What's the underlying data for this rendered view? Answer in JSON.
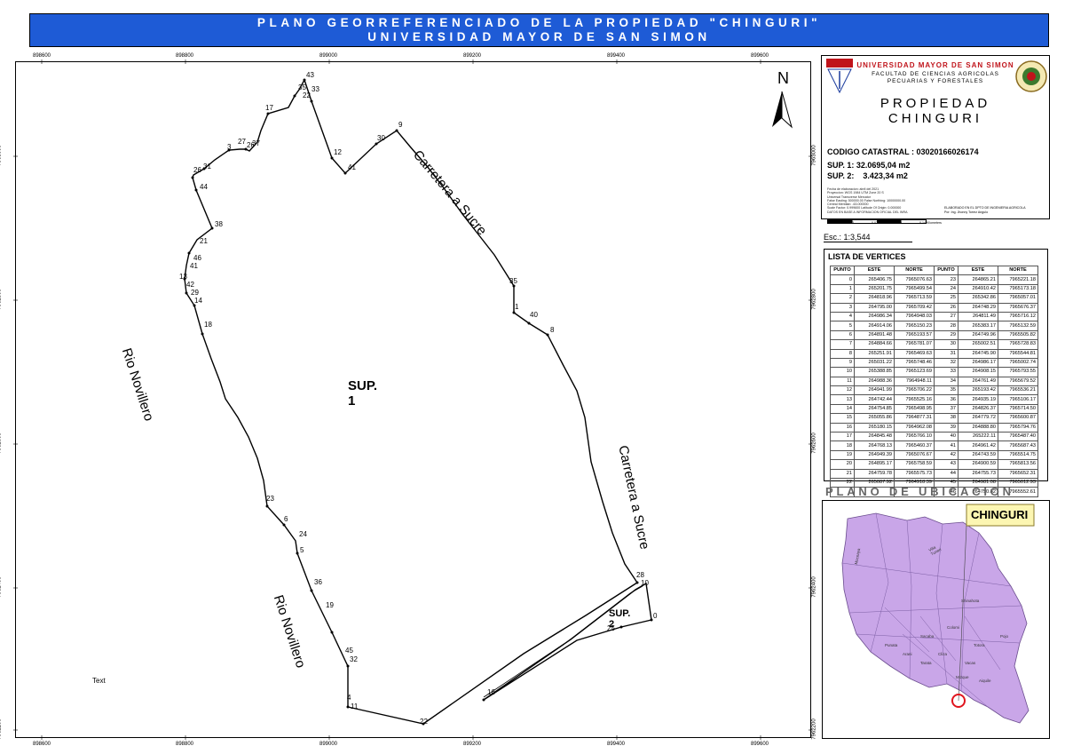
{
  "title": {
    "line1": "PLANO GEORREFERENCIADO DE LA PROPIEDAD \"CHINGURI\"",
    "line2": "UNIVERSIDAD MAYOR DE SAN SIMON"
  },
  "colors": {
    "banner": "#1e5bd6",
    "inset_land": "#c9a6e8",
    "chinguri_label_bg": "#fcf6b2",
    "marker": "#e0151e"
  },
  "map": {
    "x_ticks": [
      "898600",
      "898800",
      "899000",
      "899200",
      "899400",
      "899600"
    ],
    "y_ticks": [
      "7963000",
      "7962800",
      "7962600",
      "7962400",
      "7962200"
    ],
    "north_label": "N",
    "area_label_1": "SUP. 1",
    "area_label_2": "SUP. 2",
    "river_label": "Rio Novillero",
    "road_label": "Carretera a Sucre",
    "text_placeholder": "Text",
    "vertex_labels": [
      "43",
      "33",
      "35",
      "22",
      "17",
      "12",
      "41",
      "9",
      "30",
      "3",
      "27",
      "26",
      "37",
      "26",
      "31",
      "44",
      "38",
      "21",
      "46",
      "41",
      "13",
      "42",
      "29",
      "14",
      "18",
      "35",
      "1",
      "40",
      "8",
      "23",
      "6",
      "24",
      "5",
      "36",
      "19",
      "45",
      "32",
      "4",
      "11",
      "22",
      "16",
      "25",
      "28",
      "10",
      "0"
    ]
  },
  "panel": {
    "univ_name": "UNIVERSIDAD MAYOR DE SAN SIMON",
    "faculty_1": "FACULTAD DE CIENCIAS AGRICOLAS",
    "faculty_2": "PECUARIAS Y FORESTALES",
    "prop_1": "PROPIEDAD",
    "prop_2": "CHINGURI",
    "codigo": "CODIGO CATASTRAL : 03020166026174",
    "sup1": "SUP. 1: 32.0695,04 m2",
    "sup2": "SUP. 2:    3.423,34 m2",
    "meta_1": "Fecha de elaboracion: abril del 2021",
    "meta_2": "Proyeccion:       WGS 1984 UTM Zone 20 S",
    "meta_3": "Universal Transverse Mercator",
    "meta_4": "False Easting: 500000.00   False Northing: 10000000.00",
    "meta_5": "Central Meridian: -63.000000",
    "meta_6": "Scale Factor: 0.999600   Latitude Of Origin: 0.000000",
    "meta_7": "DATOS EN BASE A INFORMACION OFICIAL DEL INRA",
    "elab_1": "ELABORADO EN EL DPTO DE INGENIERIA AGRICOLA",
    "elab_2": "Por: Ing. Jhonny Torrez Angulo",
    "scalebar_labels": [
      "0",
      "0.03",
      "0.07",
      "0.08",
      "0.14"
    ],
    "scalebar_unit": "Kilometers",
    "scale": "Esc.:  1:3,544"
  },
  "vertices": {
    "title": "LISTA DE VERTICES",
    "headers": [
      "PUNTO",
      "ESTE",
      "NORTE",
      "PUNTO",
      "ESTE",
      "NORTE"
    ],
    "rows": [
      [
        "0",
        "265406.75",
        "7965076.63",
        "23",
        "264865.21",
        "7965221.18"
      ],
      [
        "1",
        "265201.75",
        "7965499.54",
        "24",
        "264910.42",
        "7965173.18"
      ],
      [
        "2",
        "264818.96",
        "7965713.59",
        "25",
        "265342.86",
        "7965057.01"
      ],
      [
        "3",
        "264795.00",
        "7965709.42",
        "26",
        "264748.29",
        "7965676.37"
      ],
      [
        "4",
        "264986.34",
        "7964948.03",
        "27",
        "264811.49",
        "7965716.12"
      ],
      [
        "5",
        "264914.06",
        "7965150.23",
        "28",
        "265383.17",
        "7965132.59"
      ],
      [
        "6",
        "264891.48",
        "7965193.57",
        "29",
        "264749.96",
        "7965505.82"
      ],
      [
        "7",
        "264884.66",
        "7965781.07",
        "30",
        "265002.51",
        "7965728.83"
      ],
      [
        "8",
        "265251.91",
        "7965469.63",
        "31",
        "264745.90",
        "7965544.81"
      ],
      [
        "9",
        "265031.22",
        "7965748.46",
        "32",
        "264986.17",
        "7965002.74"
      ],
      [
        "10",
        "265388.85",
        "7965123.69",
        "33",
        "264908.15",
        "7965793.55"
      ],
      [
        "11",
        "264988.36",
        "7964948.11",
        "34",
        "264761.49",
        "7965679.52"
      ],
      [
        "12",
        "264941.99",
        "7965706.22",
        "35",
        "265193.42",
        "7965536.21"
      ],
      [
        "13",
        "264742.44",
        "7965525.16",
        "36",
        "264935.19",
        "7965106.17"
      ],
      [
        "14",
        "264754.85",
        "7965498.95",
        "37",
        "264826.37",
        "7965714.50"
      ],
      [
        "15",
        "265055.86",
        "7964877.31",
        "38",
        "264779.72",
        "7965600.87"
      ],
      [
        "16",
        "265180.15",
        "7964962.08",
        "39",
        "264888.80",
        "7965794.76"
      ],
      [
        "17",
        "264845.48",
        "7965766.10",
        "40",
        "265222.11",
        "7965487.40"
      ],
      [
        "18",
        "264768.13",
        "7965460.37",
        "41",
        "264961.42",
        "7965687.43"
      ],
      [
        "19",
        "264949.39",
        "7965076.67",
        "42",
        "264743.59",
        "7965514.75"
      ],
      [
        "20",
        "264895.17",
        "7965758.59",
        "43",
        "264900.59",
        "7965813.56"
      ],
      [
        "21",
        "264759.78",
        "7965575.73",
        "44",
        "264755.73",
        "7965652.31"
      ],
      [
        "22",
        "265087.92",
        "7964918.39",
        "45",
        "264981.08",
        "7965012.93"
      ],
      [
        "",
        "",
        "",
        "46",
        "264750.82",
        "7965552.61"
      ]
    ]
  },
  "ubicacion": {
    "title": "PLANO DE UBICACION",
    "label": "CHINGURI",
    "towns": [
      "Mocnaya",
      "Villa Tunari",
      "Shinahota",
      "Colomi",
      "Sacaba",
      "Cliza",
      "Tarata",
      "Totora",
      "Pojo",
      "Aiquile",
      "Mizque",
      "Vacas",
      "Arani",
      "Punata"
    ]
  }
}
